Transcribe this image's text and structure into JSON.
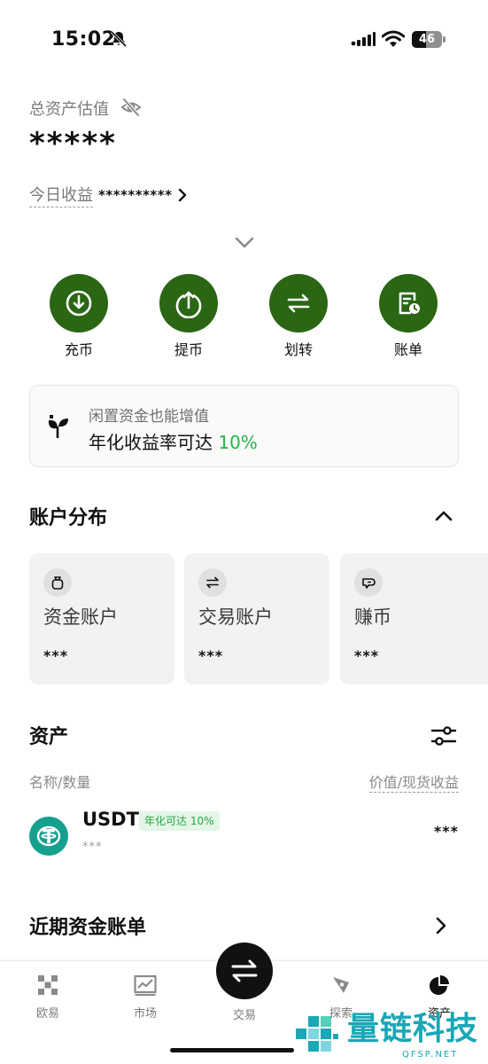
{
  "status_bar": {
    "time": "15:02",
    "battery_level": "46",
    "battery_fraction": 0.46,
    "icons": [
      "bell-slash-icon",
      "signal-icon",
      "wifi-icon",
      "battery-icon"
    ]
  },
  "assets_header": {
    "total_label": "总资产估值",
    "total_value": "*****",
    "today_label": "今日收益",
    "today_value": "**********"
  },
  "quick_actions": [
    {
      "label": "充币",
      "icon": "deposit-icon"
    },
    {
      "label": "提币",
      "icon": "withdraw-icon"
    },
    {
      "label": "划转",
      "icon": "transfer-icon"
    },
    {
      "label": "账单",
      "icon": "bill-icon"
    }
  ],
  "promo": {
    "line1": "闲置资金也能增值",
    "line2_prefix": "年化收益率可达",
    "rate": "10%"
  },
  "account_distribution": {
    "title": "账户分布",
    "cards": [
      {
        "name": "资金账户",
        "value": "***",
        "icon": "money-bag-icon"
      },
      {
        "name": "交易账户",
        "value": "***",
        "icon": "swap-icon"
      },
      {
        "name": "赚币",
        "value": "***",
        "icon": "piggy-icon"
      }
    ]
  },
  "assets": {
    "title": "资产",
    "col_left": "名称/数量",
    "col_right": "价值/现货收益",
    "rows": [
      {
        "symbol": "USDT",
        "badge": "年化可达 10%",
        "amount": "***",
        "value": "***",
        "icon": "tether-icon"
      }
    ]
  },
  "recent_bills": {
    "title": "近期资金账单"
  },
  "bottom_nav": {
    "items": [
      {
        "label": "欧易",
        "icon": "okx-logo-icon"
      },
      {
        "label": "市场",
        "icon": "market-chart-icon"
      },
      {
        "label": "交易",
        "icon": "trade-swap-icon"
      },
      {
        "label": "探索",
        "icon": "compass-icon"
      },
      {
        "label": "资产",
        "icon": "pie-chart-icon"
      }
    ]
  },
  "watermark": {
    "title": "量链科技",
    "sub": "QFSP.NET"
  },
  "colors": {
    "brand_green": "#2a6614",
    "accent_green": "#29b34a",
    "tether": "#16a08e",
    "watermark": "#1aa7b6"
  }
}
